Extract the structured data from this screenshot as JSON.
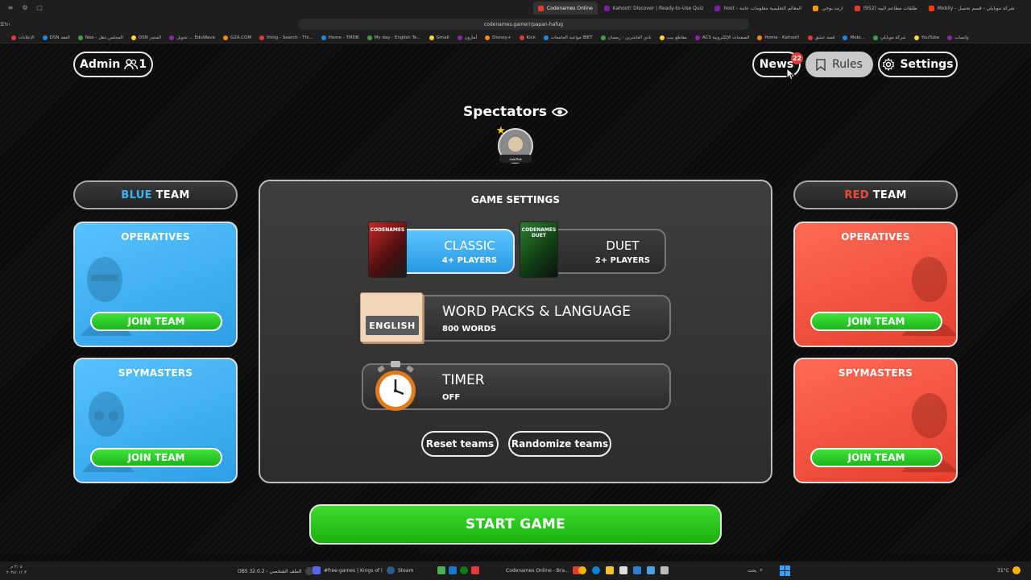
{
  "browser": {
    "tabs": [
      {
        "label": "Codenames Online",
        "active": true,
        "color": "#e53935"
      },
      {
        "label": "Kahoot! Discover | Ready-to-Use Quiz",
        "active": false,
        "color": "#7b1fa2"
      },
      {
        "label": "hoot - المعالم التعليمية معلومات عامة",
        "active": false,
        "color": "#7b1fa2"
      },
      {
        "label": "ارمد بوجي",
        "active": false,
        "color": "#ff9800"
      },
      {
        "label": "(952) طلقات مطاعم البيه",
        "active": false,
        "color": "#e53935"
      },
      {
        "label": "Mobily - شركة موبايلي - قسم تحصل",
        "active": false,
        "color": "#ff3d00"
      }
    ],
    "url": "codenames.game/r/papan-hafug",
    "bookmarks": [
      "الإعلانات",
      "DSN العقد",
      "Neo - المجلس تنقل",
      "OSN المتجر",
      "تحويل ... EduWave",
      "G2A.COM",
      "thing - Search - Thi...",
      "Home - TMDB",
      "My day - English Te...",
      "Gmail",
      "أمازون",
      "Disney+",
      "Kick",
      "مواعيد الجامعات IBET",
      "نادي العاشرين - رمضان",
      "مقاطع بيت",
      "ACS الصفحات الإلكترونية",
      "Home - Kahoot!",
      "قصة عشق",
      "Mobi...",
      "شركة موبايلي",
      "YouTube",
      "واتساب"
    ]
  },
  "header": {
    "admin_label": "Admin",
    "player_count": "1",
    "news_label": "News",
    "news_badge": "22",
    "rules_label": "Rules",
    "settings_label": "Settings"
  },
  "spectators": {
    "title": "Spectators",
    "player_name": "محمد"
  },
  "blue_team": {
    "color_word": "BLUE",
    "team_word": "TEAM",
    "operatives_label": "OPERATIVES",
    "spymasters_label": "SPYMASTERS",
    "join_label": "JOIN TEAM",
    "color": "#3ab4f2"
  },
  "red_team": {
    "color_word": "RED",
    "team_word": "TEAM",
    "operatives_label": "OPERATIVES",
    "spymasters_label": "SPYMASTERS",
    "join_label": "JOIN TEAM",
    "color": "#f0493a"
  },
  "game_settings": {
    "title": "GAME SETTINGS",
    "classic": {
      "name": "CLASSIC",
      "players": "4+ PLAYERS",
      "selected": true,
      "box_label": "CODENAMES"
    },
    "duet": {
      "name": "DUET",
      "players": "2+ PLAYERS",
      "selected": false,
      "box_label": "CODENAMES DUET"
    },
    "word_packs": {
      "title": "WORD PACKS & LANGUAGE",
      "count": "800 WORDS",
      "language": "ENGLISH"
    },
    "timer": {
      "title": "TIMER",
      "value": "OFF"
    },
    "reset_label": "Reset teams",
    "randomize_label": "Randomize teams"
  },
  "start_label": "START GAME",
  "taskbar": {
    "time": "٣:٠٥ م",
    "date": "٢٠٢٤/٠١/٠٣",
    "items": [
      "OBS 32.0.2 - الملف الشخصي",
      "#free-games | Kings of l",
      "Steam",
      "Codenames Online - Bra..."
    ],
    "search_label": "بحث",
    "weather": "31°C"
  }
}
